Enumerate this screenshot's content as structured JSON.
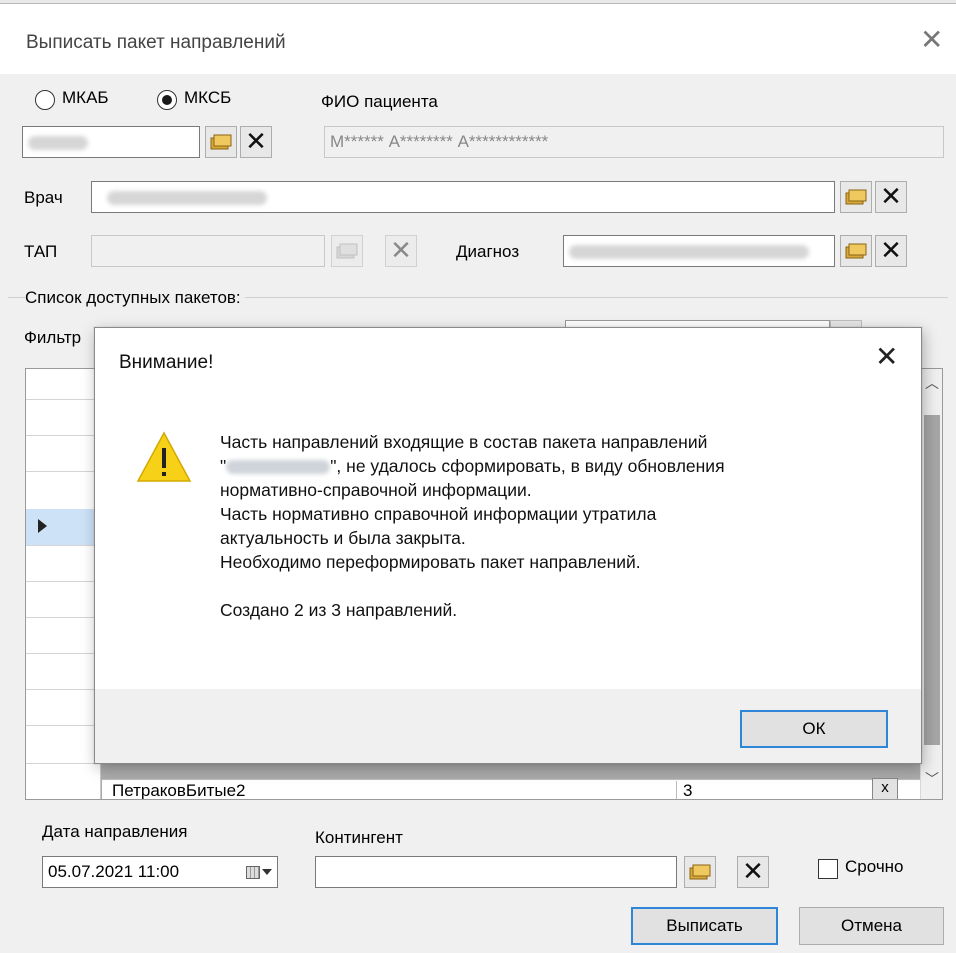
{
  "window": {
    "title": "Выписать пакет направлений",
    "close_glyph": "✕"
  },
  "patient": {
    "radio_mkab": "МКАБ",
    "radio_mksb": "МКСБ",
    "selected": "МКСБ",
    "fio_label": "ФИО пациента",
    "fio_value": "М****** А******** А************",
    "card_value_icon": "blurred"
  },
  "doctor": {
    "label": "Врач"
  },
  "tap": {
    "label": "ТАП"
  },
  "diagnosis": {
    "label": "Диагноз"
  },
  "packages": {
    "group_label": "Список доступных пакетов:",
    "filter_label": "Фильтр",
    "last_row_name": "ПетраковБитые2",
    "last_row_count": "3",
    "last_row_action": "x"
  },
  "footer": {
    "date_label": "Дата направления",
    "date_value": "05.07.2021 11:00",
    "contingent_label": "Контингент",
    "urgent_label": "Срочно",
    "urgent_checked": false,
    "submit_label": "Выписать",
    "cancel_label": "Отмена"
  },
  "dialog": {
    "title": "Внимание!",
    "close_glyph": "✕",
    "icon": "warning-icon",
    "lines": [
      "Часть направлений входящие в состав пакета направлений",
      "\"",
      "\", не удалось сформировать, в виду обновления",
      "нормативно-справочной информации.",
      "Часть нормативно справочной информации утратила",
      "актуальность и была закрыта.",
      "Необходимо переформировать пакет направлений."
    ],
    "summary": "Создано 2 из 3 направлений.",
    "ok_label": "ОК"
  },
  "colors": {
    "accent": "#2f86d8",
    "warning": "#f7d117",
    "background": "#f0f0f0"
  }
}
